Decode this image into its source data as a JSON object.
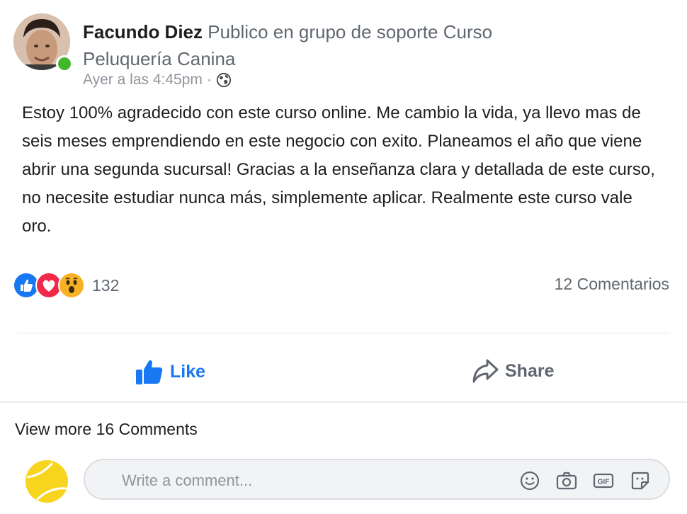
{
  "post": {
    "author": "Facundo Diez",
    "action": "Publico en grupo de soporte Curso Peluquería Canina",
    "timestamp": "Ayer a las 4:45pm",
    "separator": "·",
    "body": "Estoy 100% agradecido con este curso online. Me cambio la vida, ya llevo mas de seis meses emprendiendo en este negocio con exito. Planeamos el año que viene abrir una segunda sucursal! Gracias a la enseñanza clara y detallada de este curso, no necesite estudiar nunca más, simplemente aplicar. Realmente este curso vale oro."
  },
  "reactions": {
    "types": [
      "like-icon",
      "love-icon",
      "wow-icon"
    ],
    "count": "132",
    "comments": "12 Comentarios"
  },
  "actions": {
    "like_label": "Like",
    "share_label": "Share"
  },
  "comments": {
    "view_more": "View more 16 Comments",
    "placeholder": "Write a comment..."
  },
  "colors": {
    "accent": "#1877f2",
    "online": "#42b72a",
    "love": "#f0284a",
    "wow": "#f7b125"
  }
}
